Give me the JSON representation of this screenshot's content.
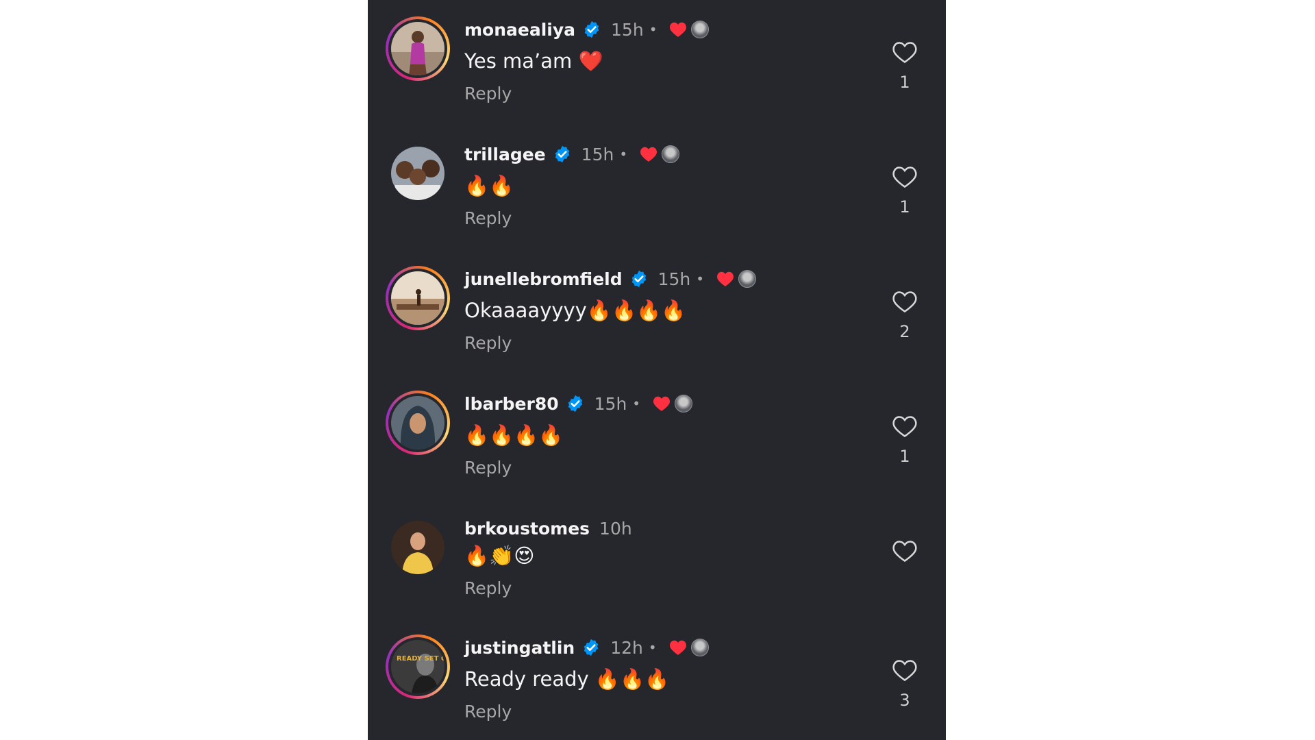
{
  "colors": {
    "background": "#25272c",
    "verified_badge": "#0095f6",
    "liked_heart": "#ff3040",
    "secondary_text": "#a8a8a8"
  },
  "icons": {
    "verified": "verified-badge-icon",
    "creator_liked": "red-heart-icon",
    "like": "heart-outline-icon"
  },
  "comments": [
    {
      "username": "monaealiya",
      "verified": true,
      "time": "15h",
      "dot": "•",
      "creator_liked": true,
      "text": "Yes ma’am ❤️",
      "reply": "Reply",
      "likes": "1",
      "story_ring": true
    },
    {
      "username": "trillagee",
      "verified": true,
      "time": "15h",
      "dot": "•",
      "creator_liked": true,
      "text": "🔥🔥",
      "reply": "Reply",
      "likes": "1",
      "story_ring": false
    },
    {
      "username": "junellebromfield",
      "verified": true,
      "time": "15h",
      "dot": "•",
      "creator_liked": true,
      "text": "Okaaaayyyy🔥🔥🔥🔥",
      "reply": "Reply",
      "likes": "2",
      "story_ring": true
    },
    {
      "username": "lbarber80",
      "verified": true,
      "time": "15h",
      "dot": "•",
      "creator_liked": true,
      "text": "🔥🔥🔥🔥",
      "reply": "Reply",
      "likes": "1",
      "story_ring": true
    },
    {
      "username": "brkoustomes",
      "verified": false,
      "time": "10h",
      "dot": "",
      "creator_liked": false,
      "text": "🔥👏😍",
      "reply": "Reply",
      "likes": "",
      "story_ring": false
    },
    {
      "username": "justingatlin",
      "verified": true,
      "time": "12h",
      "dot": "•",
      "creator_liked": true,
      "text": "Ready ready 🔥🔥🔥",
      "reply": "Reply",
      "likes": "3",
      "story_ring": true,
      "avatar_text": "READY SET GO"
    }
  ]
}
